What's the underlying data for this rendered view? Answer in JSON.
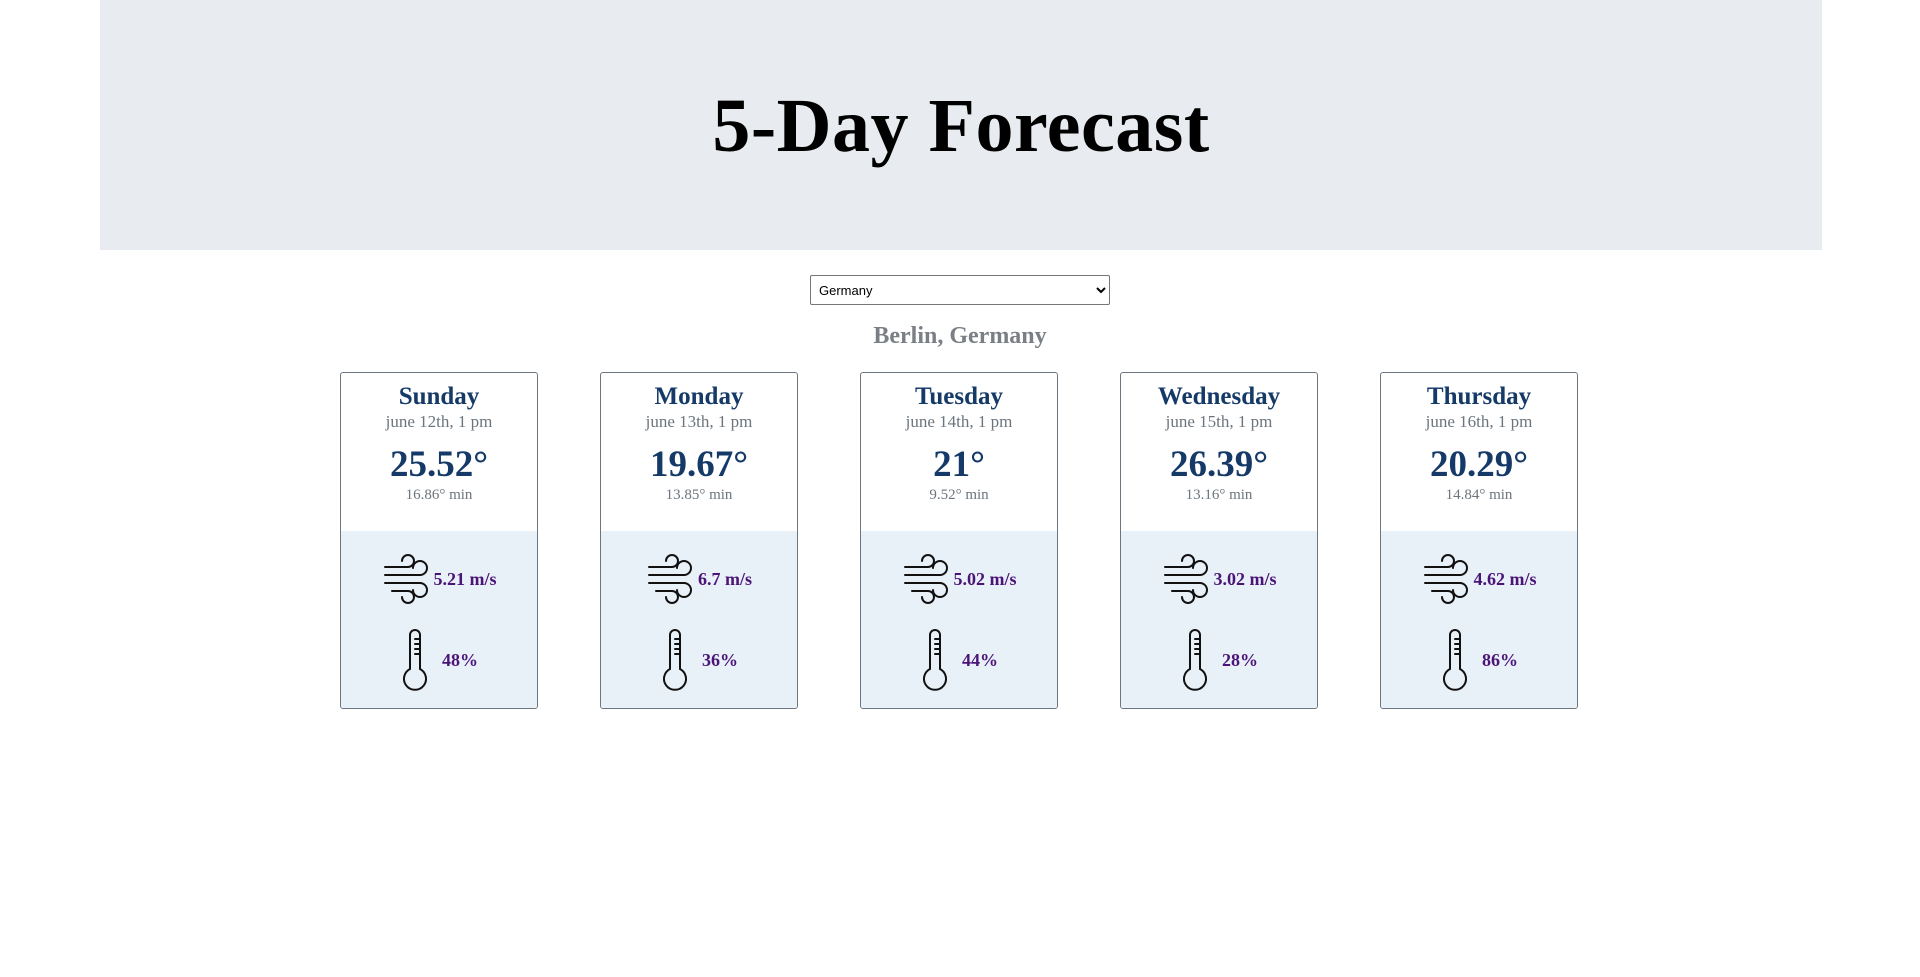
{
  "header": {
    "title": "5-Day Forecast"
  },
  "country_select": {
    "selected": "Germany",
    "icon": "chevron-down-icon"
  },
  "location": "Berlin, Germany",
  "forecast": [
    {
      "day": "Sunday",
      "date": "june 12th, 1 pm",
      "temp": "25.52°",
      "min": "16.86° min",
      "wind": "5.21 m/s",
      "humidity": "48%"
    },
    {
      "day": "Monday",
      "date": "june 13th, 1 pm",
      "temp": "19.67°",
      "min": "13.85° min",
      "wind": "6.7 m/s",
      "humidity": "36%"
    },
    {
      "day": "Tuesday",
      "date": "june 14th, 1 pm",
      "temp": "21°",
      "min": "9.52° min",
      "wind": "5.02 m/s",
      "humidity": "44%"
    },
    {
      "day": "Wednesday",
      "date": "june 15th, 1 pm",
      "temp": "26.39°",
      "min": "13.16° min",
      "wind": "3.02 m/s",
      "humidity": "28%"
    },
    {
      "day": "Thursday",
      "date": "june 16th, 1 pm",
      "temp": "20.29°",
      "min": "14.84° min",
      "wind": "4.62 m/s",
      "humidity": "86%"
    }
  ],
  "icons": {
    "wind": "wind-icon",
    "humidity": "thermometer-icon"
  },
  "colors": {
    "header_bg": "#e8ecf0",
    "day_text": "#163a68",
    "muted_text": "#6c757d",
    "stat_text": "#4b1477",
    "card_bottom_bg": "#e8f0f8"
  }
}
